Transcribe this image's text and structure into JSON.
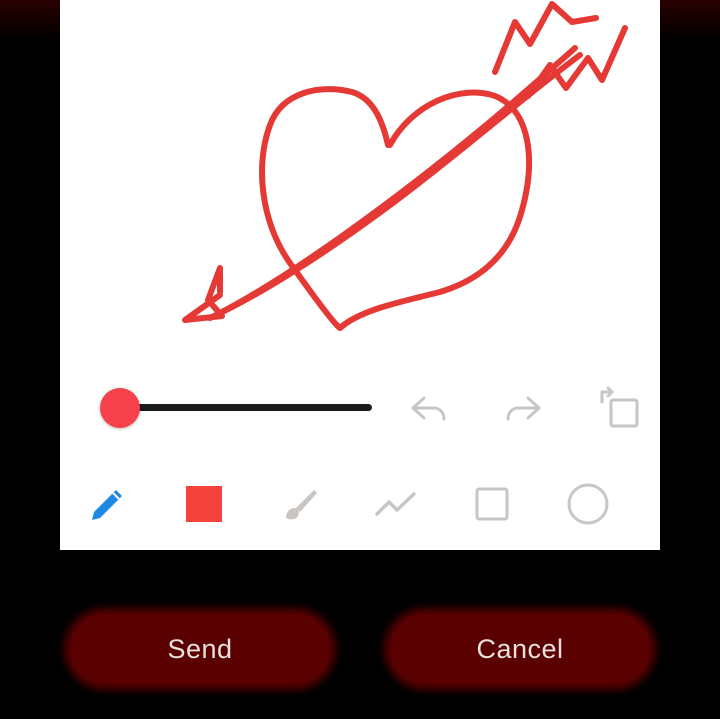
{
  "buttons": {
    "send_label": "Send",
    "cancel_label": "Cancel"
  },
  "brush": {
    "color": "#f4414a",
    "size_level": 0.0
  },
  "tools": [
    {
      "name": "pencil",
      "icon": "pencil-icon",
      "selected": true
    },
    {
      "name": "color",
      "icon": "color-swatch-icon",
      "color": "#f4433c"
    },
    {
      "name": "brush",
      "icon": "brush-icon"
    },
    {
      "name": "line",
      "icon": "polyline-icon"
    },
    {
      "name": "rectangle",
      "icon": "rectangle-icon"
    },
    {
      "name": "circle",
      "icon": "circle-icon"
    }
  ],
  "actions": [
    {
      "name": "undo",
      "icon": "undo-icon"
    },
    {
      "name": "redo",
      "icon": "redo-icon"
    },
    {
      "name": "rotate",
      "icon": "rotate-icon"
    }
  ],
  "colors": {
    "accent_blue": "#1e88e5",
    "stroke_red": "#e53935",
    "icon_gray": "#c9c5c2",
    "button_bg": "#5a0000"
  }
}
